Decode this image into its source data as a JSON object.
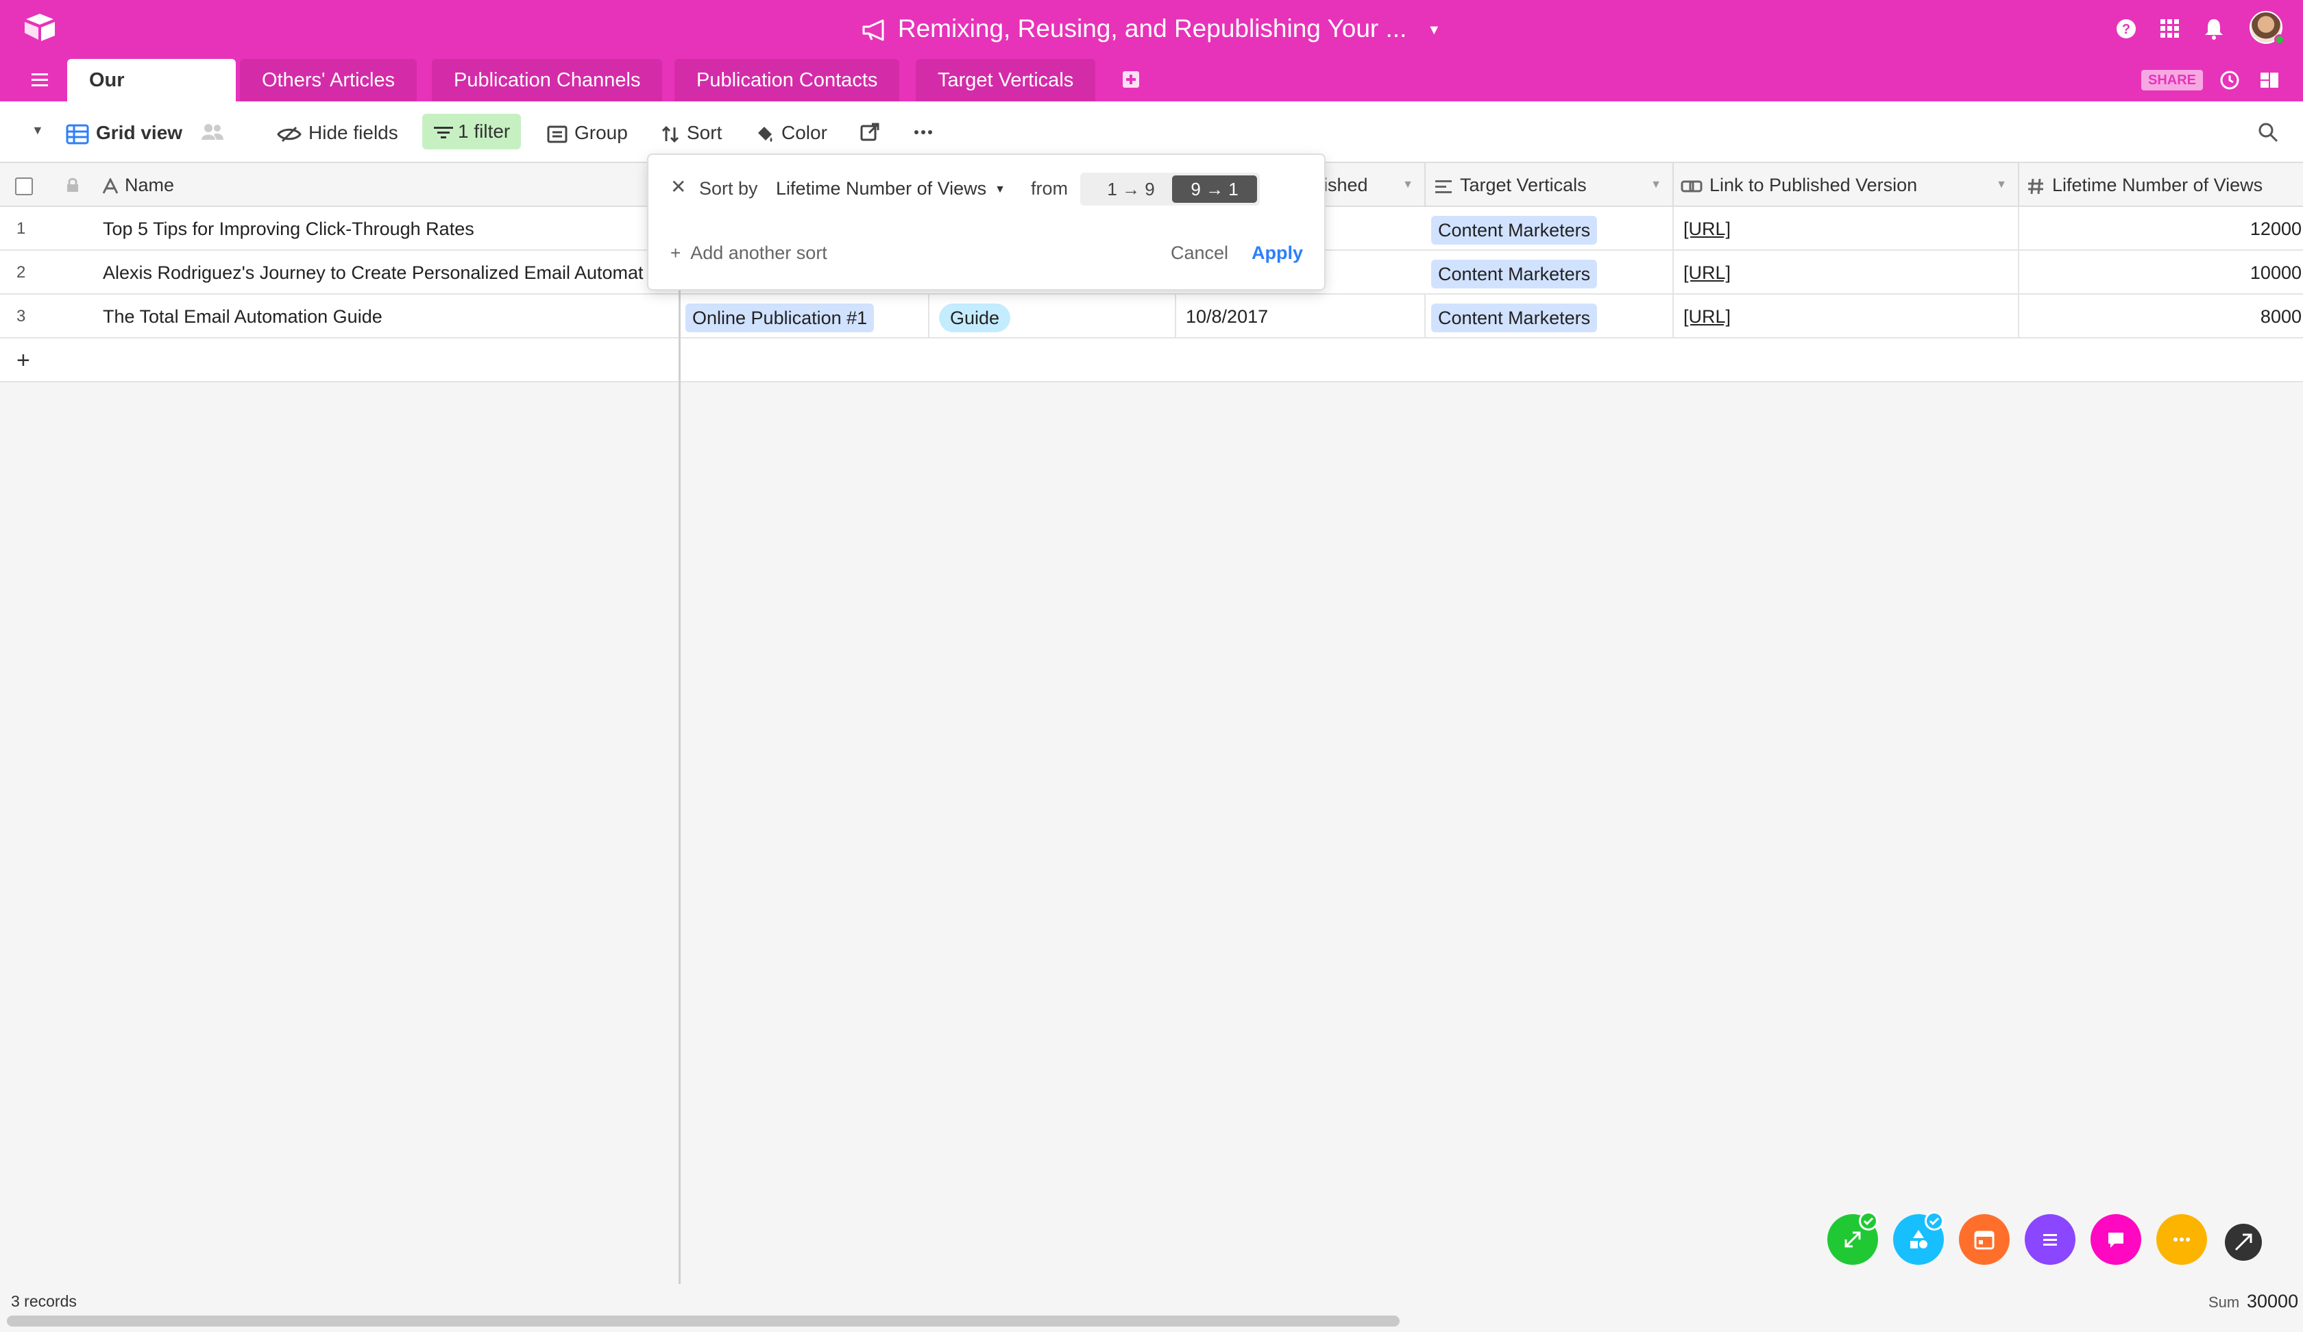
{
  "app": {
    "base_title": "Remixing, Reusing, and Republishing Your ...",
    "share_label": "SHARE"
  },
  "tabs": [
    {
      "label": "Our Articles",
      "active": true
    },
    {
      "label": "Others' Articles",
      "active": false
    },
    {
      "label": "Publication Channels",
      "active": false
    },
    {
      "label": "Publication Contacts",
      "active": false
    },
    {
      "label": "Target Verticals",
      "active": false
    }
  ],
  "viewbar": {
    "view_name": "Grid view",
    "hide_fields": "Hide fields",
    "filter": "1 filter",
    "group": "Group",
    "sort": "Sort",
    "color": "Color"
  },
  "columns": {
    "name": "Name",
    "published": "blished",
    "target_verticals": "Target Verticals",
    "link": "Link to Published Version",
    "views": "Lifetime Number of Views"
  },
  "rows": [
    {
      "num": "1",
      "name": "Top 5 Tips for Improving Click-Through Rates",
      "channel": "",
      "type": "",
      "date": "",
      "vertical": "Content Marketers",
      "link": "[URL]",
      "views": "12000"
    },
    {
      "num": "2",
      "name": "Alexis Rodriguez's Journey to Create Personalized Email Automat",
      "channel": "",
      "type": "",
      "date": "",
      "vertical": "Content Marketers",
      "link": "[URL]",
      "views": "10000"
    },
    {
      "num": "3",
      "name": "The Total Email Automation Guide",
      "channel": "Online Publication #1",
      "type": "Guide",
      "date": "10/8/2017",
      "vertical": "Content Marketers",
      "link": "[URL]",
      "views": "8000"
    }
  ],
  "sort_popover": {
    "sort_by": "Sort by",
    "field": "Lifetime Number of Views",
    "from": "from",
    "asc": "1 → 9",
    "desc": "9 → 1",
    "add_another": "Add another sort",
    "cancel": "Cancel",
    "apply": "Apply"
  },
  "footer": {
    "records": "3 records",
    "sum_label": "Sum",
    "sum_value": "30000"
  },
  "colors": {
    "brand": "#e733b9",
    "filter_bg": "#c7f0c2",
    "apply": "#2d7ff9",
    "bubbles": [
      "#20c933",
      "#18bfff",
      "#ff6f2c",
      "#8b46ff",
      "#ff08c2",
      "#fcb400",
      "#333333"
    ]
  },
  "icons": {
    "logo": "airtable-logo-icon",
    "megaphone": "megaphone-icon",
    "help": "help-icon",
    "apps": "apps-grid-icon",
    "bell": "bell-icon",
    "history": "history-icon",
    "panel": "panel-icon",
    "search": "search-icon"
  }
}
